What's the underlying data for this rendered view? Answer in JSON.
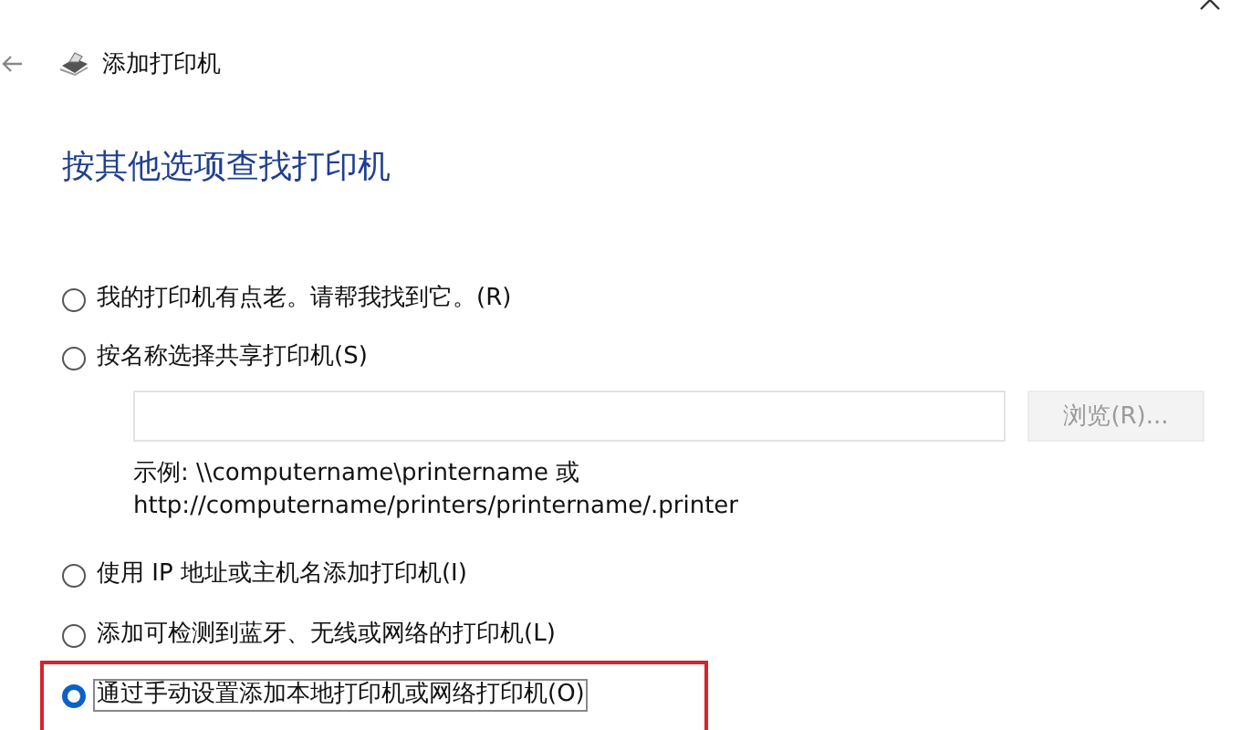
{
  "window": {
    "title": "添加打印机"
  },
  "heading": "按其他选项查找打印机",
  "options": [
    {
      "label": "我的打印机有点老。请帮我找到它。(R)",
      "selected": false
    },
    {
      "label": "按名称选择共享打印机(S)",
      "selected": false
    },
    {
      "label": "使用 IP 地址或主机名添加打印机(I)",
      "selected": false
    },
    {
      "label": "添加可检测到蓝牙、无线或网络的打印机(L)",
      "selected": false
    },
    {
      "label": "通过手动设置添加本地打印机或网络打印机(O)",
      "selected": true,
      "highlighted": true
    }
  ],
  "share_name": {
    "browse_button": {
      "label": "浏览(R)...",
      "disabled": true
    },
    "example_lines": [
      "示例: \\\\computername\\printername 或",
      "http://computername/printers/printername/.printer"
    ]
  }
}
